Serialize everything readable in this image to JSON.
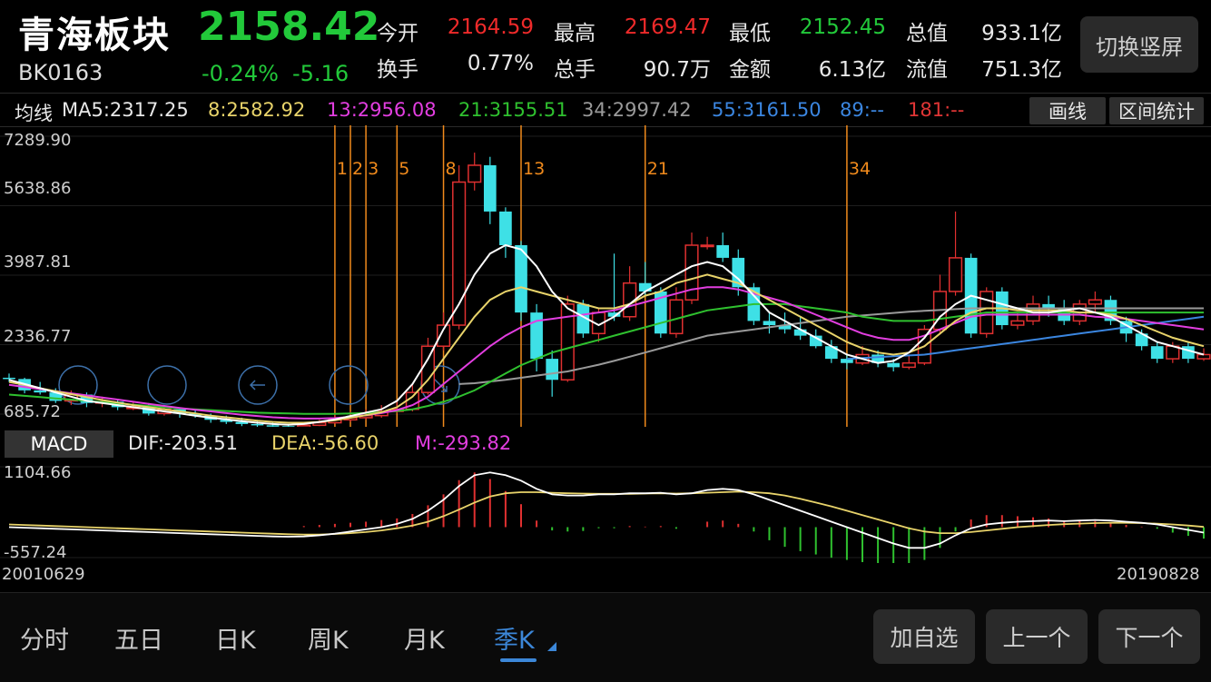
{
  "header": {
    "title": "青海板块",
    "code": "BK0163",
    "price": "2158.42",
    "change_pct": "-0.24%",
    "change_abs": "-5.16",
    "stats": [
      {
        "label": "今开",
        "value": "2164.59",
        "color": "#ee2a2a"
      },
      {
        "label": "最高",
        "value": "2169.47",
        "color": "#ee2a2a"
      },
      {
        "label": "最低",
        "value": "2152.45",
        "color": "#22c93a"
      },
      {
        "label": "总值",
        "value": "933.1亿",
        "color": "#e8e8e8"
      },
      {
        "label": "换手",
        "value": "0.77%",
        "color": "#e8e8e8"
      },
      {
        "label": "总手",
        "value": "90.7万",
        "color": "#e8e8e8"
      },
      {
        "label": "金额",
        "value": "6.13亿",
        "color": "#e8e8e8"
      },
      {
        "label": "流值",
        "value": "751.3亿",
        "color": "#e8e8e8"
      }
    ],
    "switch_label": "切换竖屏"
  },
  "ma_bar": {
    "label": "均线",
    "items": [
      {
        "text": "MA5:2317.25",
        "color": "#e8e8e8"
      },
      {
        "text": "8:2582.92",
        "color": "#e8d36a"
      },
      {
        "text": "13:2956.08",
        "color": "#e23ee0"
      },
      {
        "text": "21:3155.51",
        "color": "#2fc12f"
      },
      {
        "text": "34:2997.42",
        "color": "#9a9a9a"
      },
      {
        "text": "55:3161.50",
        "color": "#3b86e0"
      },
      {
        "text": "89:--",
        "color": "#3b86e0"
      },
      {
        "text": "181:--",
        "color": "#e03535"
      }
    ],
    "draw_label": "画线",
    "range_stats_label": "区间统计"
  },
  "chart_data": [
    {
      "type": "candlestick",
      "y_ticks": [
        "7289.90",
        "5638.86",
        "3987.81",
        "2336.77",
        "685.72"
      ],
      "fib_marker_labels": [
        "1",
        "2",
        "3",
        "5",
        "8",
        "13",
        "21",
        "34"
      ],
      "colors": {
        "up": "#e03030",
        "down": "#3ee0e6",
        "fib_line": "#f08a1c"
      },
      "candles": [
        [
          1550,
          1520,
          1650,
          1450
        ],
        [
          1520,
          1250,
          1550,
          1180
        ],
        [
          1250,
          1200,
          1450,
          1150
        ],
        [
          1200,
          1000,
          1300,
          950
        ],
        [
          1000,
          1150,
          1250,
          900
        ],
        [
          1150,
          950,
          1200,
          850
        ],
        [
          950,
          980,
          1100,
          850
        ],
        [
          980,
          850,
          1050,
          780
        ],
        [
          850,
          850,
          1000,
          780
        ],
        [
          850,
          700,
          950,
          650
        ],
        [
          700,
          800,
          900,
          650
        ],
        [
          800,
          700,
          850,
          600
        ],
        [
          700,
          650,
          800,
          600
        ],
        [
          650,
          550,
          700,
          480
        ],
        [
          550,
          500,
          650,
          450
        ],
        [
          500,
          450,
          600,
          400
        ],
        [
          450,
          420,
          550,
          380
        ],
        [
          420,
          400,
          500,
          350
        ],
        [
          400,
          380,
          450,
          300
        ],
        [
          380,
          420,
          500,
          330
        ],
        [
          420,
          480,
          550,
          400
        ],
        [
          480,
          550,
          700,
          450
        ],
        [
          550,
          600,
          750,
          500
        ],
        [
          600,
          650,
          800,
          550
        ],
        [
          650,
          750,
          900,
          600
        ],
        [
          750,
          800,
          1000,
          700
        ],
        [
          800,
          1200,
          1400,
          750
        ],
        [
          1200,
          2300,
          2500,
          1150
        ],
        [
          2300,
          2800,
          3100,
          2200
        ],
        [
          2800,
          6200,
          6600,
          2700
        ],
        [
          6200,
          6600,
          6900,
          6000
        ],
        [
          6600,
          5500,
          6800,
          5200
        ],
        [
          5500,
          4700,
          5600,
          4400
        ],
        [
          4700,
          3100,
          4800,
          2900
        ],
        [
          3100,
          2000,
          3300,
          1700
        ],
        [
          2000,
          1500,
          2200,
          1100
        ],
        [
          1500,
          3300,
          3500,
          1450
        ],
        [
          3300,
          2600,
          3400,
          2500
        ],
        [
          2600,
          3100,
          3200,
          2400
        ],
        [
          3100,
          3000,
          4500,
          2900
        ],
        [
          3000,
          3800,
          4200,
          2900
        ],
        [
          3800,
          3600,
          4300,
          3500
        ],
        [
          3600,
          2600,
          3700,
          2500
        ],
        [
          2600,
          3400,
          3700,
          2500
        ],
        [
          3400,
          4700,
          5000,
          3300
        ],
        [
          4700,
          4700,
          4900,
          4600
        ],
        [
          4700,
          4400,
          5000,
          4300
        ],
        [
          4400,
          3700,
          4600,
          3500
        ],
        [
          3700,
          2900,
          3800,
          2800
        ],
        [
          2900,
          2800,
          3100,
          2600
        ],
        [
          2800,
          2700,
          3100,
          2600
        ],
        [
          2700,
          2550,
          3000,
          2450
        ],
        [
          2550,
          2300,
          2700,
          2250
        ],
        [
          2300,
          2000,
          2450,
          1900
        ],
        [
          2000,
          1900,
          2100,
          1750
        ],
        [
          1900,
          2100,
          2300,
          1850
        ],
        [
          2100,
          1900,
          2200,
          1800
        ],
        [
          1900,
          1800,
          2000,
          1700
        ],
        [
          1800,
          1900,
          2100,
          1750
        ],
        [
          1900,
          2700,
          2800,
          1850
        ],
        [
          2700,
          3600,
          4000,
          2600
        ],
        [
          3600,
          4400,
          5500,
          3500
        ],
        [
          4400,
          2600,
          4500,
          2500
        ],
        [
          2600,
          3600,
          3700,
          2500
        ],
        [
          3600,
          2800,
          3700,
          2700
        ],
        [
          2800,
          2900,
          3100,
          2700
        ],
        [
          2900,
          3300,
          3500,
          2800
        ],
        [
          3300,
          3200,
          3500,
          3000
        ],
        [
          3200,
          2900,
          3400,
          2800
        ],
        [
          2900,
          3300,
          3400,
          2800
        ],
        [
          3300,
          3400,
          3600,
          3100
        ],
        [
          3400,
          2900,
          3500,
          2800
        ],
        [
          2900,
          2600,
          3000,
          2400
        ],
        [
          2600,
          2300,
          2700,
          2200
        ],
        [
          2300,
          2000,
          2400,
          1900
        ],
        [
          2000,
          2300,
          2400,
          1900
        ],
        [
          2300,
          2000,
          2400,
          1900
        ],
        [
          2000,
          2100,
          2250,
          1950
        ]
      ],
      "ma5": [
        1500,
        1400,
        1300,
        1200,
        1100,
        1000,
        950,
        900,
        850,
        800,
        750,
        700,
        650,
        600,
        560,
        520,
        480,
        450,
        430,
        450,
        500,
        560,
        640,
        720,
        800,
        1000,
        1400,
        2000,
        2700,
        3300,
        4000,
        4500,
        4700,
        4600,
        4200,
        3600,
        3200,
        3000,
        2800,
        3000,
        3300,
        3600,
        3800,
        4000,
        4200,
        4300,
        4200,
        3900,
        3500,
        3100,
        2900,
        2700,
        2500,
        2300,
        2100,
        2000,
        1900,
        1950,
        2150,
        2500,
        3000,
        3300,
        3500,
        3400,
        3300,
        3200,
        3100,
        3100,
        3150,
        3200,
        3100,
        3000,
        2800,
        2600,
        2400,
        2300,
        2200,
        2100
      ],
      "ma8": [
        1450,
        1380,
        1300,
        1230,
        1160,
        1090,
        1020,
        960,
        900,
        850,
        800,
        750,
        700,
        650,
        610,
        570,
        530,
        500,
        480,
        480,
        500,
        540,
        600,
        660,
        730,
        850,
        1100,
        1500,
        2000,
        2500,
        3000,
        3400,
        3600,
        3700,
        3600,
        3500,
        3400,
        3300,
        3200,
        3200,
        3300,
        3500,
        3600,
        3800,
        3900,
        4000,
        3900,
        3800,
        3600,
        3400,
        3200,
        3000,
        2800,
        2600,
        2400,
        2250,
        2150,
        2100,
        2150,
        2300,
        2600,
        2900,
        3100,
        3200,
        3200,
        3150,
        3150,
        3150,
        3150,
        3100,
        3100,
        3050,
        2950,
        2800,
        2650,
        2500,
        2400,
        2300
      ],
      "ma13": [
        1380,
        1330,
        1280,
        1230,
        1180,
        1130,
        1080,
        1030,
        980,
        930,
        880,
        830,
        790,
        750,
        710,
        670,
        640,
        610,
        590,
        580,
        580,
        590,
        620,
        660,
        710,
        780,
        900,
        1100,
        1400,
        1700,
        2000,
        2300,
        2550,
        2750,
        2900,
        2950,
        3000,
        3050,
        3100,
        3150,
        3250,
        3350,
        3450,
        3550,
        3650,
        3700,
        3700,
        3650,
        3550,
        3450,
        3350,
        3200,
        3050,
        2900,
        2750,
        2600,
        2500,
        2450,
        2450,
        2550,
        2700,
        2850,
        3000,
        3050,
        3050,
        3050,
        3050,
        3050,
        3050,
        3050,
        3000,
        2980,
        2950,
        2900,
        2850,
        2800,
        2750,
        2700
      ],
      "ma21": [
        1150,
        1120,
        1090,
        1060,
        1030,
        1000,
        970,
        940,
        910,
        880,
        850,
        820,
        800,
        780,
        760,
        740,
        720,
        710,
        700,
        690,
        690,
        690,
        700,
        710,
        730,
        760,
        800,
        880,
        980,
        1100,
        1250,
        1450,
        1650,
        1850,
        2000,
        2150,
        2250,
        2350,
        2450,
        2550,
        2650,
        2750,
        2850,
        2950,
        3050,
        3150,
        3200,
        3250,
        3300,
        3300,
        3300,
        3250,
        3200,
        3150,
        3100,
        3000,
        2950,
        2900,
        2900,
        2900,
        2950,
        3000,
        3050,
        3100,
        3100,
        3100,
        3100,
        3100,
        3100,
        3100,
        3100,
        3100,
        3100,
        3100,
        3100,
        3100,
        3100,
        3100
      ],
      "ma34": [
        null,
        null,
        null,
        null,
        null,
        null,
        null,
        null,
        null,
        null,
        null,
        null,
        null,
        null,
        null,
        null,
        null,
        null,
        null,
        null,
        null,
        null,
        null,
        null,
        null,
        null,
        null,
        null,
        null,
        1400,
        1420,
        1460,
        1500,
        1550,
        1600,
        1650,
        1700,
        1780,
        1860,
        1950,
        2050,
        2150,
        2250,
        2350,
        2450,
        2550,
        2600,
        2650,
        2700,
        2750,
        2800,
        2850,
        2900,
        2950,
        3000,
        3030,
        3060,
        3090,
        3120,
        3140,
        3160,
        3180,
        3200,
        3200,
        3200,
        3200,
        3200,
        3200,
        3200,
        3200,
        3200,
        3200,
        3200,
        3200,
        3200,
        3200,
        3200,
        3200
      ],
      "ma55": [
        null,
        null,
        null,
        null,
        null,
        null,
        null,
        null,
        null,
        null,
        null,
        null,
        null,
        null,
        null,
        null,
        null,
        null,
        null,
        null,
        null,
        null,
        null,
        null,
        null,
        null,
        null,
        null,
        null,
        null,
        null,
        null,
        null,
        null,
        null,
        null,
        null,
        null,
        null,
        null,
        null,
        null,
        null,
        null,
        null,
        null,
        null,
        null,
        null,
        null,
        null,
        null,
        null,
        null,
        2000,
        2020,
        2040,
        2060,
        2080,
        2100,
        2150,
        2200,
        2250,
        2300,
        2350,
        2400,
        2450,
        2500,
        2550,
        2600,
        2650,
        2700,
        2750,
        2800,
        2850,
        2900,
        2950,
        3000
      ]
    },
    {
      "type": "macd",
      "y_ticks": [
        "1104.66",
        "-557.24"
      ],
      "x_start_label": "20010629",
      "x_end_label": "20190828",
      "dif": [
        0,
        -10,
        -20,
        -30,
        -40,
        -50,
        -60,
        -70,
        -80,
        -90,
        -100,
        -110,
        -120,
        -130,
        -140,
        -150,
        -160,
        -170,
        -175,
        -170,
        -150,
        -120,
        -80,
        -40,
        0,
        60,
        150,
        300,
        500,
        750,
        950,
        1000,
        950,
        850,
        700,
        600,
        580,
        580,
        600,
        600,
        620,
        620,
        630,
        600,
        620,
        680,
        700,
        680,
        600,
        500,
        400,
        300,
        200,
        100,
        0,
        -100,
        -200,
        -300,
        -380,
        -380,
        -300,
        -150,
        -20,
        50,
        80,
        100,
        110,
        120,
        110,
        120,
        130,
        120,
        100,
        80,
        50,
        0,
        -50,
        -100
      ],
      "dea": [
        50,
        40,
        30,
        20,
        10,
        0,
        -10,
        -20,
        -30,
        -40,
        -50,
        -60,
        -70,
        -80,
        -90,
        -100,
        -110,
        -120,
        -130,
        -135,
        -135,
        -125,
        -110,
        -90,
        -60,
        -20,
        30,
        100,
        200,
        320,
        450,
        560,
        620,
        640,
        640,
        630,
        620,
        615,
        610,
        610,
        610,
        615,
        620,
        615,
        620,
        630,
        640,
        650,
        640,
        620,
        580,
        520,
        450,
        380,
        300,
        220,
        140,
        60,
        -20,
        -80,
        -110,
        -110,
        -90,
        -60,
        -30,
        0,
        20,
        40,
        55,
        65,
        75,
        80,
        80,
        75,
        65,
        50,
        30,
        5
      ],
      "hist": [
        0,
        0,
        0,
        0,
        0,
        0,
        0,
        0,
        0,
        0,
        0,
        0,
        0,
        0,
        0,
        0,
        0,
        0,
        0,
        20,
        40,
        60,
        80,
        100,
        130,
        160,
        240,
        400,
        600,
        860,
        1000,
        880,
        660,
        420,
        120,
        -60,
        -80,
        -70,
        -20,
        -20,
        20,
        10,
        20,
        -30,
        0,
        100,
        120,
        60,
        -80,
        -240,
        -360,
        -440,
        -500,
        -560,
        -600,
        -640,
        -680,
        -720,
        -720,
        -600,
        -380,
        -80,
        140,
        220,
        220,
        200,
        180,
        160,
        110,
        110,
        110,
        80,
        40,
        10,
        -30,
        -100,
        -160,
        -210
      ]
    }
  ],
  "bottom_tabs": [
    "分时",
    "五日",
    "日K",
    "周K",
    "月K",
    "季K"
  ],
  "active_tab": "季K",
  "bottom_buttons": [
    "加自选",
    "上一个",
    "下一个"
  ]
}
